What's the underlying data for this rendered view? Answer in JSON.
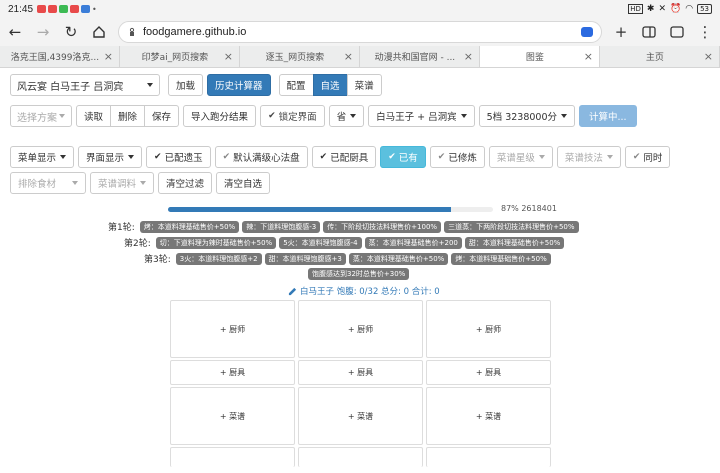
{
  "status": {
    "time": "21:45",
    "battery": "53"
  },
  "browser": {
    "url": "foodgamere.github.io",
    "tabs_count": "",
    "tabs": [
      {
        "label": "洛克王国,4399洛克...",
        "active": false
      },
      {
        "label": "印梦ai_网页搜索",
        "active": false
      },
      {
        "label": "逐玉_网页搜索",
        "active": false
      },
      {
        "label": "动漫共和国官网 - ...",
        "active": false
      },
      {
        "label": "图鉴",
        "active": true
      },
      {
        "label": "主页",
        "active": false
      }
    ]
  },
  "toolbar1": {
    "recipe_select": "风云宴 白马王子 吕洞宾",
    "load": "加载",
    "history": "历史计算器",
    "config": "配置",
    "self_select": "自选",
    "menu": "菜谱"
  },
  "toolbar2": {
    "choose_plan": "选择方案",
    "read": "读取",
    "delete": "删除",
    "save": "保存",
    "import": "导入跑分结果",
    "lock": "锁定界面",
    "province": "省",
    "chef_combo": "白马王子 + 吕洞宾",
    "score": "5档 3238000分",
    "calculating": "计算中..."
  },
  "toolbar3": {
    "menu_display": "菜单显示",
    "ui_display": "界面显示",
    "jade": "已配遗玉",
    "default_heart": "默认满级心法盘",
    "kitchenware": "已配厨具",
    "owned": "已有",
    "cultivated": "已修炼",
    "recipe_star": "菜谱星级",
    "recipe_skill": "菜谱技法",
    "same_time": "同时",
    "exclude_ingredient": "排除食材",
    "recipe_seasoning": "菜谱调料",
    "clear_filter": "清空过滤",
    "clear_self": "清空自选"
  },
  "progress": {
    "percent": 87,
    "text": "87% 2618401"
  },
  "rounds": [
    {
      "label": "第1轮:",
      "tags": [
        "烤：本道料理基础售价+50%",
        "辣：下道料理饱腹感-3",
        "传：下阶段切技法料理售价+100%",
        "三道蒸：下两阶段切技法料理售价+50%"
      ]
    },
    {
      "label": "第2轮:",
      "tags": [
        "切：下道料理为辣时基础售价+50%",
        "5火：本道料理饱腹感-4",
        "蒸：本道料理基础售价+200",
        "甜：本道料理基础售价+50%"
      ]
    },
    {
      "label": "第3轮:",
      "tags": [
        "3火：本道料理饱腹感+2",
        "甜：本道料理饱腹感+3",
        "蒸：本道料理基础售价+50%",
        "烤：本道料理基础售价+50%"
      ]
    },
    {
      "label": "",
      "tags": [
        "饱腹感达到32时总售价+30%"
      ]
    }
  ],
  "summary": "白马王子 饱腹: 0/32 总分: 0 合计: 0",
  "grid": {
    "row1": [
      "+ 厨师",
      "+ 厨师",
      "+ 厨师"
    ],
    "row2": [
      "+ 厨具",
      "+ 厨具",
      "+ 厨具"
    ],
    "row3": [
      "+ 菜谱",
      "+ 菜谱",
      "+ 菜谱"
    ]
  }
}
